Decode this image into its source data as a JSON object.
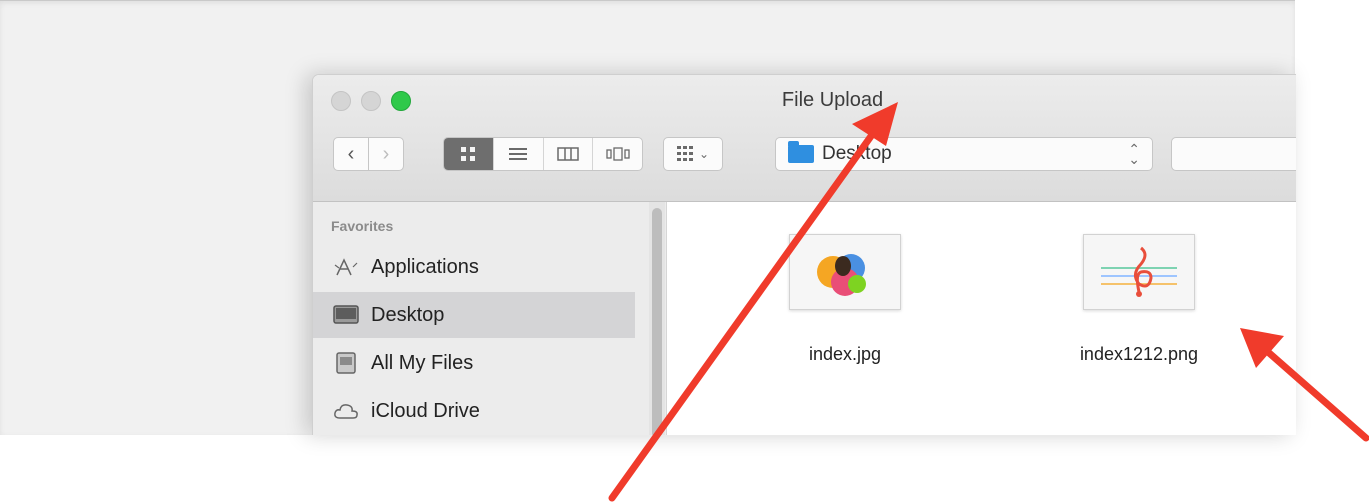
{
  "window": {
    "title": "File Upload",
    "colors": {
      "zoom": "#2fc94a",
      "folder": "#2f8fe0",
      "arrow": "#f03b2b"
    }
  },
  "toolbar": {
    "back_icon": "chevron-left-icon",
    "forward_icon": "chevron-right-icon",
    "views": [
      {
        "name": "icon-view",
        "active": true
      },
      {
        "name": "list-view",
        "active": false
      },
      {
        "name": "column-view",
        "active": false
      },
      {
        "name": "cover-flow-view",
        "active": false
      }
    ],
    "arrange_icon": "grid-arrange-icon",
    "location": "Desktop",
    "search_value": ""
  },
  "sidebar": {
    "heading": "Favorites",
    "items": [
      {
        "label": "Applications",
        "icon": "applications-icon",
        "selected": false
      },
      {
        "label": "Desktop",
        "icon": "desktop-icon",
        "selected": true
      },
      {
        "label": "All My Files",
        "icon": "all-files-icon",
        "selected": false
      },
      {
        "label": "iCloud Drive",
        "icon": "cloud-icon",
        "selected": false
      }
    ]
  },
  "files": [
    {
      "name": "index.jpg"
    },
    {
      "name": "index1212.png"
    }
  ]
}
